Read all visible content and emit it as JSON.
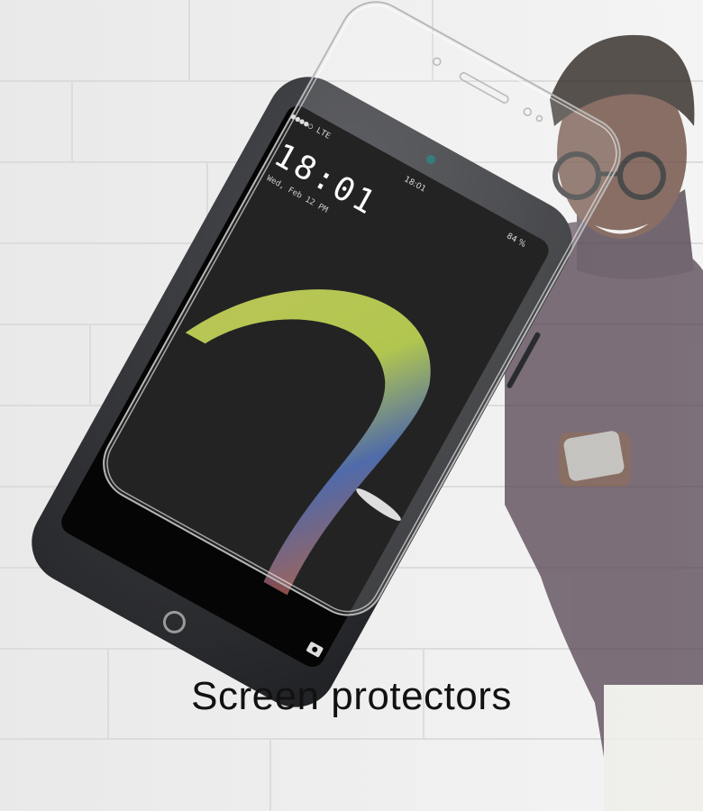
{
  "caption": "Screen protectors",
  "phone": {
    "status_carrier": "●●●●○ LTE",
    "status_battery": "84 %",
    "status_small_time": "18:01",
    "clock_time": "18:01",
    "clock_date": "Wed, Feb 12 PM",
    "shortcut_icon": "camera-icon",
    "home_icon": "fingerprint-icon"
  },
  "colors": {
    "wall": "#ededed",
    "phone_body": "#2f3033",
    "screen": "#050505",
    "sweater": "#5a4a57",
    "skin": "#6b4a3c",
    "glass_edge": "#bbbbbb"
  }
}
